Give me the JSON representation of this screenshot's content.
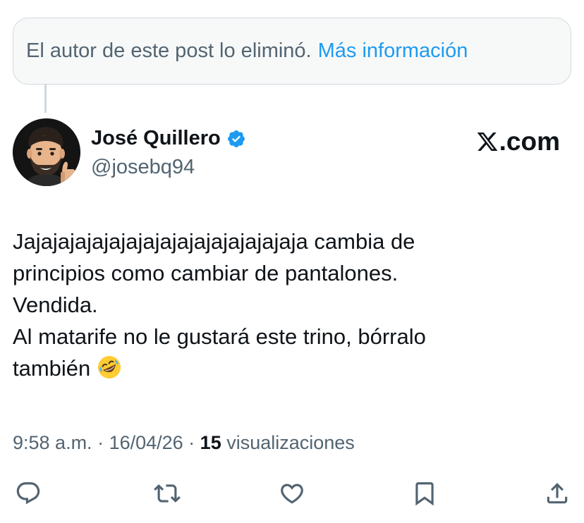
{
  "notice": {
    "text": "El autor de este post lo eliminó.",
    "link": "Más información"
  },
  "author": {
    "name": "José Quillero",
    "handle": "@josebq94",
    "verified": true
  },
  "brand": {
    "suffix": ".com"
  },
  "tweet": {
    "lines": [
      "Jajajajajajajajajajajajajajajajaja cambia de",
      "principios como cambiar de pantalones.",
      "Vendida.",
      "Al matarife no le gustará este trino, bórralo",
      "también"
    ],
    "emoji": "rolling-on-floor-laughing-emoji"
  },
  "meta": {
    "time": "9:58 a.m.",
    "sep1": " · ",
    "date": "16/04/26",
    "sep2": " · ",
    "views_count": "15",
    "views_label": " visualizaciones"
  },
  "actions": [
    "reply-icon",
    "retweet-icon",
    "like-icon",
    "bookmark-icon",
    "share-icon"
  ],
  "colors": {
    "link": "#1d9bf0",
    "muted": "#536471",
    "text": "#0f1419",
    "verified": "#1d9bf0",
    "notice_bg": "#f7f9f9",
    "border": "#cfd9de"
  }
}
